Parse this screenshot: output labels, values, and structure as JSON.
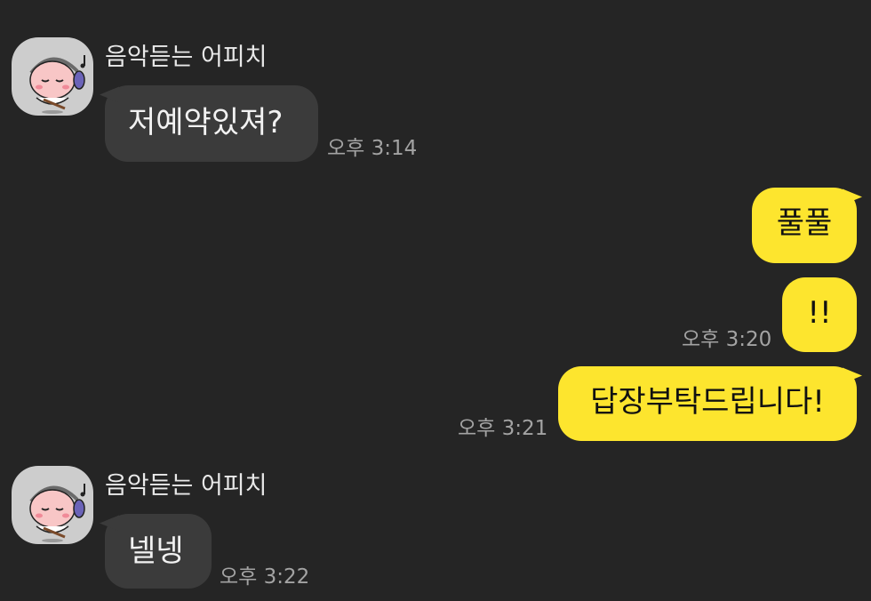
{
  "messages": [
    {
      "direction": "incoming",
      "sender": "음악듣는 어피치",
      "avatar_icon": "apeach-headphones-avatar-icon",
      "text": "저예약있져?",
      "time": "오후 3:14"
    },
    {
      "direction": "outgoing",
      "text": "풀풀",
      "time": ""
    },
    {
      "direction": "outgoing",
      "text": "!!",
      "time": "오후 3:20"
    },
    {
      "direction": "outgoing",
      "text": "답장부탁드립니다!",
      "time": "오후 3:21"
    },
    {
      "direction": "incoming",
      "sender": "음악듣는 어피치",
      "avatar_icon": "apeach-headphones-avatar-icon",
      "text": "넬넹",
      "time": "오후 3:22"
    }
  ],
  "colors": {
    "background": "#252525",
    "incoming_bubble": "#3b3b3b",
    "outgoing_bubble": "#fde52e",
    "timestamp": "#a3a3a3",
    "sender_name": "#e9e9e9"
  }
}
